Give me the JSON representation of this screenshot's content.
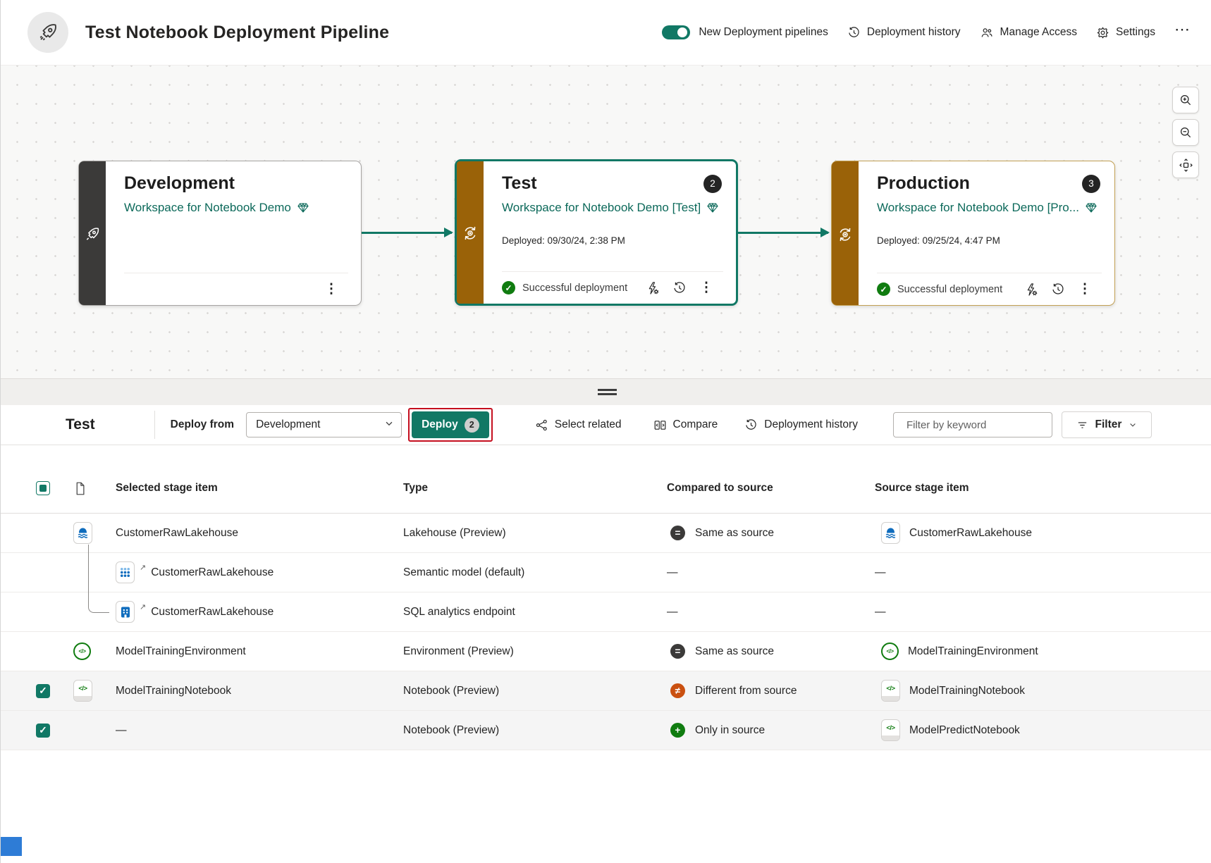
{
  "app": {
    "title": "Test Notebook Deployment Pipeline"
  },
  "header": {
    "toggle_label": "New Deployment pipelines",
    "toggle_on": true,
    "deployment_history_label": "Deployment history",
    "manage_access_label": "Manage Access",
    "settings_label": "Settings",
    "more_label": "⋯"
  },
  "canvas": {
    "stages": [
      {
        "name": "Development",
        "workspace": "Workspace for Notebook Demo",
        "badge": "",
        "deployed": "",
        "status": ""
      },
      {
        "name": "Test",
        "workspace": "Workspace for Notebook Demo [Test]",
        "badge": "2",
        "deployed": "Deployed: 09/30/24, 2:38 PM",
        "status": "Successful deployment"
      },
      {
        "name": "Production",
        "workspace": "Workspace for Notebook Demo [Pro...",
        "badge": "3",
        "deployed": "Deployed: 09/25/24, 4:47 PM",
        "status": "Successful deployment"
      }
    ],
    "zoom_controls": [
      "zoom-in",
      "zoom-out",
      "fit-view"
    ]
  },
  "toolbar": {
    "stage_title": "Test",
    "deploy_from_label": "Deploy from",
    "deploy_from_value": "Development",
    "deploy_label": "Deploy",
    "deploy_count": "2",
    "select_related_label": "Select related",
    "compare_label": "Compare",
    "history_label": "Deployment history",
    "search_placeholder": "Filter by keyword",
    "filter_label": "Filter"
  },
  "table": {
    "headers": {
      "item": "Selected stage item",
      "type": "Type",
      "compared": "Compared to source",
      "source": "Source stage item"
    },
    "rows": [
      {
        "checked": false,
        "child": false,
        "icon": "lakehouse",
        "name": "CustomerRawLakehouse",
        "type": "Lakehouse (Preview)",
        "compared_icon": "same",
        "compared": "Same as source",
        "source_icon": "lakehouse",
        "source": "CustomerRawLakehouse",
        "selected": false
      },
      {
        "checked": false,
        "child": true,
        "icon": "semantic-model",
        "name": "CustomerRawLakehouse",
        "type": "Semantic model (default)",
        "compared_icon": null,
        "compared": "—",
        "source_icon": null,
        "source": "—",
        "selected": false
      },
      {
        "checked": false,
        "child": true,
        "icon": "sql-endpoint",
        "name": "CustomerRawLakehouse",
        "type": "SQL analytics endpoint",
        "compared_icon": null,
        "compared": "—",
        "source_icon": null,
        "source": "—",
        "selected": false
      },
      {
        "checked": false,
        "child": false,
        "icon": "environment",
        "name": "ModelTrainingEnvironment",
        "type": "Environment (Preview)",
        "compared_icon": "same",
        "compared": "Same as source",
        "source_icon": "environment",
        "source": "ModelTrainingEnvironment",
        "selected": false
      },
      {
        "checked": true,
        "child": false,
        "icon": "notebook",
        "name": "ModelTrainingNotebook",
        "type": "Notebook (Preview)",
        "compared_icon": "different",
        "compared": "Different from source",
        "source_icon": "notebook",
        "source": "ModelTrainingNotebook",
        "selected": true
      },
      {
        "checked": true,
        "child": false,
        "icon": null,
        "name": "—",
        "type": "Notebook (Preview)",
        "compared_icon": "only",
        "compared": "Only in source",
        "source_icon": "notebook",
        "source": "ModelPredictNotebook",
        "selected": true
      }
    ]
  },
  "colors": {
    "accent": "#117865",
    "golden": "#9A6208",
    "dark_strip": "#3B3A39",
    "same": "#3B3A39",
    "different": "#CA5010",
    "only_in_source": "#107C10",
    "success": "#107C10",
    "focus_red": "#C50F1F",
    "item_blue": "#0F6CBD"
  },
  "compared_glyphs": {
    "same": "=",
    "different": "≠",
    "only": "+"
  }
}
